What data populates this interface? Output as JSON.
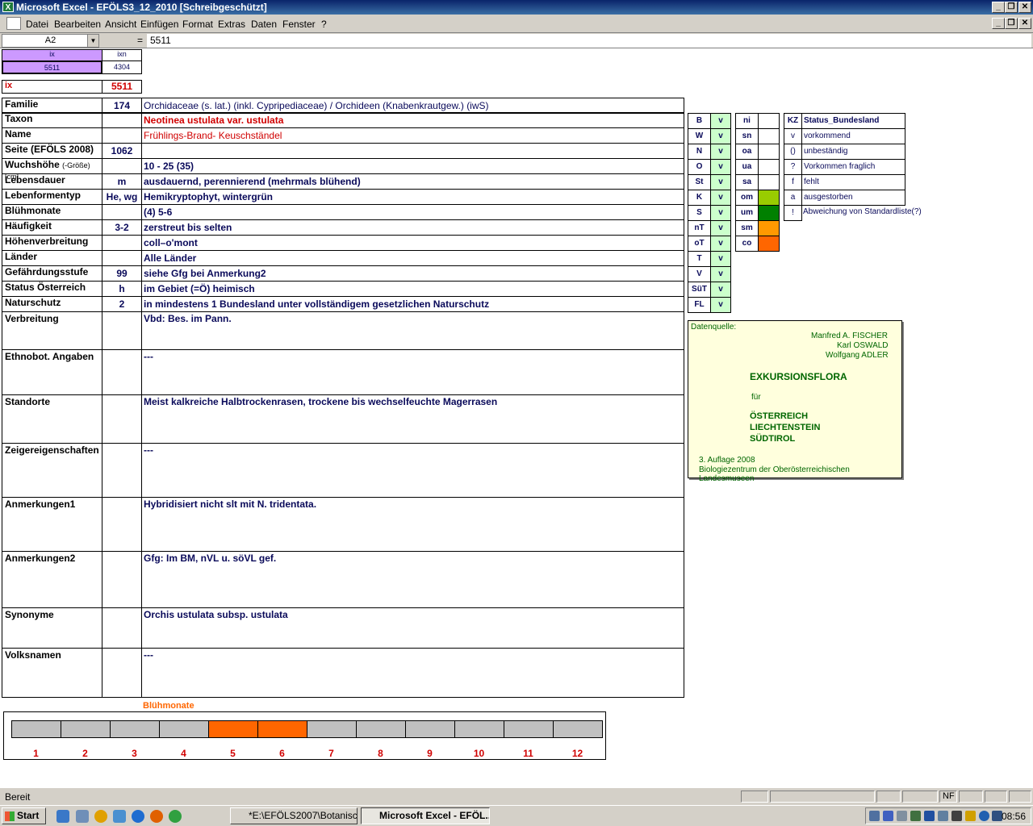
{
  "window": {
    "title": "Microsoft Excel - EFÖLS3_12_2010  [Schreibgeschützt]",
    "logo": "X"
  },
  "menu": [
    "Datei",
    "Bearbeiten",
    "Ansicht",
    "Einfügen",
    "Format",
    "Extras",
    "Daten",
    "Fenster",
    "?"
  ],
  "formula": {
    "namebox": "A2",
    "eq": "=",
    "value": "5511"
  },
  "top": {
    "h1": "ix",
    "h2": "ixn",
    "v1": "5511",
    "v2": "4304",
    "ix_label": "ix",
    "ix_value": "5511"
  },
  "rows": [
    {
      "label": "Familie",
      "mid": "174",
      "value": "Orchidaceae (s. lat.) (inkl. Cypripediaceae)  /  Orchideen (Knabenkrautgew.) (iwS)"
    },
    {
      "label": "Taxon",
      "mid": "",
      "value": "Neotinea ustulata var. ustulata"
    },
    {
      "label": "Name",
      "mid": "",
      "value": "Frühlings-Brand- Keuschständel"
    },
    {
      "label": "Seite (EFÖLS 2008)",
      "mid": "1062",
      "value": ""
    },
    {
      "label": "Wuchshöhe",
      "label_small": "(-Größe) [cm]",
      "mid": "",
      "value": " 10 - 25 (35)"
    },
    {
      "label": "Lebensdauer",
      "mid": "m",
      "value": "ausdauernd, perennierend (mehrmals blühend)"
    },
    {
      "label": "Lebenformentyp",
      "mid": "He, wg",
      "value": "Hemikryptophyt, wintergrün"
    },
    {
      "label": "Blühmonate",
      "mid": "",
      "value": "(4) 5-6"
    },
    {
      "label": "Häufigkeit",
      "mid": "3-2",
      "value": "zerstreut bis selten"
    },
    {
      "label": "Höhenverbreitung",
      "mid": "",
      "value": "coll–o'mont"
    },
    {
      "label": "Länder",
      "mid": "",
      "value": "Alle Länder"
    },
    {
      "label": "Gefährdungsstufe",
      "mid": "99",
      "value": "siehe Gfg bei Anmerkung2"
    },
    {
      "label": "Status Österreich",
      "mid": "h",
      "value": "im Gebiet (=Ö) heimisch"
    },
    {
      "label": "Naturschutz",
      "mid": "2",
      "value": "in mindestens 1 Bundesland unter vollständigem gesetzlichen Naturschutz"
    }
  ],
  "big_rows": [
    {
      "label": "Verbreitung",
      "value": "Vbd: Bes. im Pann."
    },
    {
      "label": "Ethnobot. Angaben",
      "value": "---"
    },
    {
      "label": "Standorte",
      "value": "Meist kalkreiche Halbtrockenrasen, trockene bis wechselfeuchte Magerrasen"
    },
    {
      "label": "Zeigereigenschaften",
      "value": "---"
    },
    {
      "label": "Anmerkungen1",
      "value": "Hybridisiert nicht slt mit N. tridentata."
    },
    {
      "label": "Anmerkungen2",
      "value": "Gfg: Im BM, nVL u. söVL gef."
    },
    {
      "label": "Synonyme",
      "value": "Orchis ustulata subsp. ustulata"
    },
    {
      "label": "Volksnamen",
      "value": "---"
    }
  ],
  "laender": [
    {
      "k": "B",
      "v": "v"
    },
    {
      "k": "W",
      "v": "v"
    },
    {
      "k": "N",
      "v": "v"
    },
    {
      "k": "O",
      "v": "v"
    },
    {
      "k": "St",
      "v": "v"
    },
    {
      "k": "K",
      "v": "v"
    },
    {
      "k": "S",
      "v": "v"
    },
    {
      "k": "nT",
      "v": "v"
    },
    {
      "k": "oT",
      "v": "v"
    },
    {
      "k": "T",
      "v": "v"
    },
    {
      "k": "V",
      "v": "v"
    },
    {
      "k": "SüT",
      "v": "v"
    },
    {
      "k": "FL",
      "v": "v"
    }
  ],
  "hoehe": [
    {
      "k": "ni",
      "color": ""
    },
    {
      "k": "sn",
      "color": ""
    },
    {
      "k": "oa",
      "color": ""
    },
    {
      "k": "ua",
      "color": ""
    },
    {
      "k": "sa",
      "color": ""
    },
    {
      "k": "om",
      "color": "#99cc00"
    },
    {
      "k": "um",
      "color": "#008000"
    },
    {
      "k": "sm",
      "color": "#ff9900"
    },
    {
      "k": "co",
      "color": "#ff6600"
    }
  ],
  "status_legend": {
    "header_k": "KZ",
    "header_v": "Status_Bundesland",
    "items": [
      {
        "k": "v",
        "v": "vorkommend"
      },
      {
        "k": "()",
        "v": "unbeständig"
      },
      {
        "k": "?",
        "v": "Vorkommen fraglich"
      },
      {
        "k": "f",
        "v": "fehlt"
      },
      {
        "k": "a",
        "v": "ausgestorben"
      },
      {
        "k": "!",
        "v": "Abweichung von Standardliste(?)"
      }
    ]
  },
  "datenquelle": {
    "label": "Datenquelle:",
    "a1": "Manfred A. FISCHER",
    "a2": "Karl OSWALD",
    "a3": "Wolfgang ADLER",
    "t1": "EXKURSIONSFLORA",
    "fuer": "für",
    "c1": "ÖSTERREICH",
    "c2": "LIECHTENSTEIN",
    "c3": "SÜDTIROL",
    "ed": "3. Auflage 2008",
    "pub": "Biologiezentrum der Oberösterreichischen Landesmuseen"
  },
  "months": {
    "title": "Blühmonate",
    "labels": [
      "1",
      "2",
      "3",
      "4",
      "5",
      "6",
      "7",
      "8",
      "9",
      "10",
      "11",
      "12"
    ],
    "active": [
      5,
      6
    ],
    "active_color": "#ff6600",
    "inactive_color": "#c0c0c0"
  },
  "statusbar": {
    "text": "Bereit",
    "nf": "NF"
  },
  "taskbar": {
    "start": "Start",
    "tasks": [
      "*E:\\EFÖLS2007\\Botanisc...",
      "Microsoft Excel - EFÖL..."
    ],
    "clock": "08:56"
  }
}
